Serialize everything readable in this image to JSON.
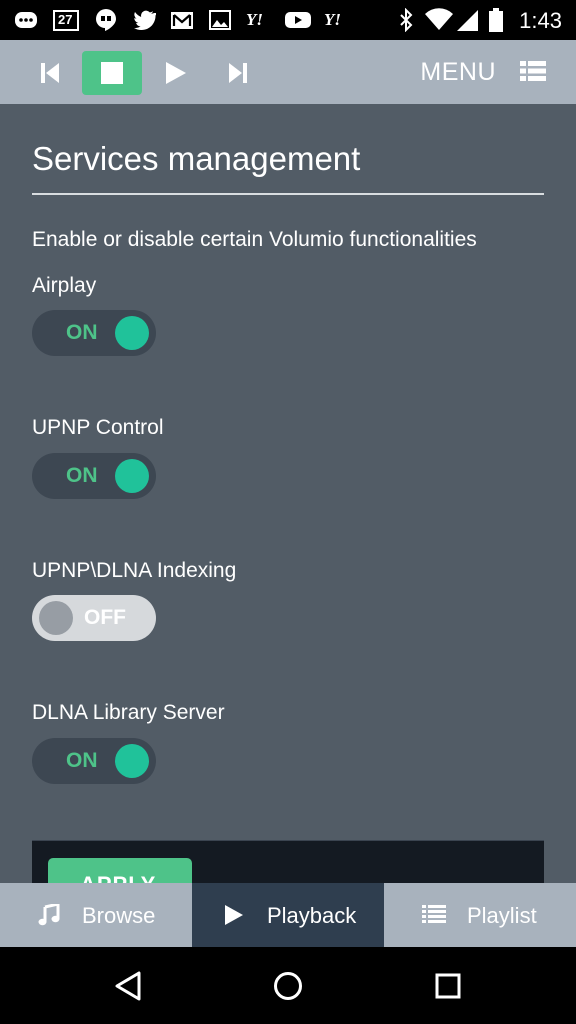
{
  "status_bar": {
    "time": "1:43",
    "icons": [
      "messages-icon",
      "calendar-icon",
      "hangouts-icon",
      "twitter-icon",
      "gmail-icon",
      "gallery-icon",
      "yahoo-icon",
      "youtube-icon",
      "yahoo-icon",
      "bluetooth-icon",
      "wifi-icon",
      "signal-icon",
      "battery-icon"
    ],
    "calendar_day": "27",
    "yahoo_text": "Y!"
  },
  "player": {
    "menu_label": "MENU",
    "accent": "#4ec389"
  },
  "page": {
    "title": "Services management",
    "description": "Enable or disable certain Volumio functionalities"
  },
  "services": [
    {
      "label": "Airplay",
      "state": "ON"
    },
    {
      "label": "UPNP Control",
      "state": "ON"
    },
    {
      "label": "UPNP\\DLNA Indexing",
      "state": "OFF"
    },
    {
      "label": "DLNA Library Server",
      "state": "ON"
    }
  ],
  "apply": {
    "label": "APPLY"
  },
  "tabs": [
    {
      "label": "Browse",
      "icon": "music-note-icon"
    },
    {
      "label": "Playback",
      "icon": "play-icon"
    },
    {
      "label": "Playlist",
      "icon": "list-icon"
    }
  ],
  "colors": {
    "background": "#525c66",
    "toolbar": "#a8b2bd",
    "toggle_on_knob": "#20c29a",
    "active_tab": "#2f3e4f"
  }
}
